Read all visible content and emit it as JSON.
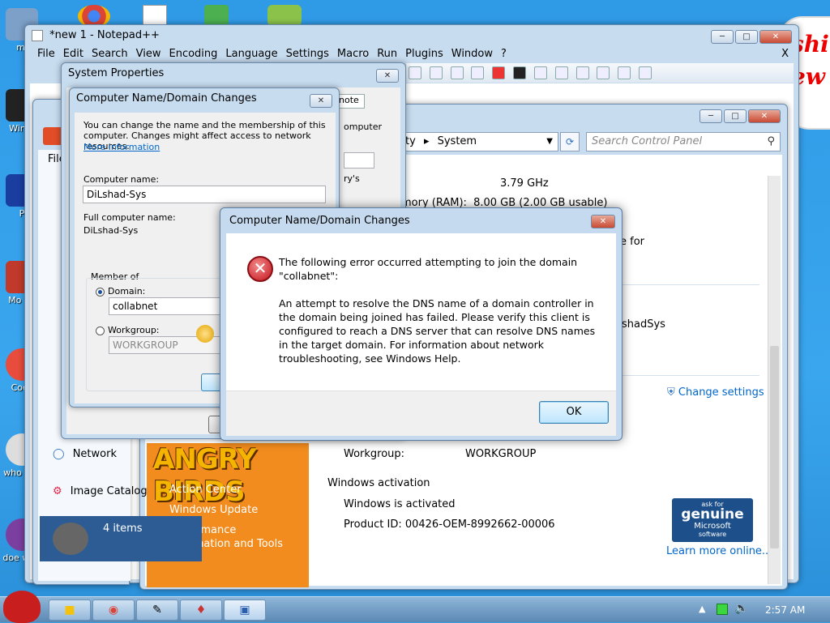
{
  "desktop": {
    "icons": [
      {
        "label": "mi",
        "color": "#7ca0c8"
      },
      {
        "label": "Win V",
        "color": "#222222"
      },
      {
        "label": "P",
        "color": "#1a3ea0"
      },
      {
        "label": "Mo Re",
        "color": "#c0392b"
      },
      {
        "label": "Cock",
        "color": "#e74c3c"
      },
      {
        "label": "who use",
        "color": "#dddddd"
      },
      {
        "label": "doe worl",
        "color": "#7b3fa0"
      }
    ],
    "bubble_text": [
      "shi",
      "ew"
    ]
  },
  "notepad": {
    "title": "*new  1 - Notepad++",
    "menu": [
      "File",
      "Edit",
      "Search",
      "View",
      "Encoding",
      "Language",
      "Settings",
      "Macro",
      "Run",
      "Plugins",
      "Window",
      "?"
    ],
    "menu_close": "X"
  },
  "sysprops": {
    "title": "System Properties",
    "tab_partial": "note",
    "frag_computer": "omputer",
    "frag_ys": "ry's"
  },
  "namechange": {
    "title": "Computer Name/Domain Changes",
    "description": "You can change the name and the membership of this computer. Changes might affect access to network resources.",
    "more_info": "More information",
    "computer_name_label": "Computer name:",
    "computer_name_value": "DiLshad-Sys",
    "full_name_label": "Full computer name:",
    "full_name_value": "DiLshad-Sys",
    "member_of_label": "Member of",
    "domain_label": "Domain:",
    "domain_value": "collabnet",
    "workgroup_label": "Workgroup:",
    "workgroup_value": "WORKGROUP"
  },
  "controlpanel": {
    "breadcrumb_partial": "ty",
    "breadcrumb_current": "System",
    "search_placeholder": "Search Control Panel",
    "file_menu_partial": "File",
    "cpu_speed": "3.79 GHz",
    "memory_label": "mory (RAM):",
    "memory_value": "8.00 GB (2.00 GB usable)",
    "frag_for": "e for",
    "frag_shadsys": "shadSys",
    "change_settings": "Change settings",
    "network_label": "Network",
    "image_catalog_label": "Image Catalog",
    "items_count": "4 items",
    "workgroup_label": "Workgroup:",
    "workgroup_value": "WORKGROUP",
    "activation_heading": "Windows activation",
    "activation_status": "Windows is activated",
    "product_id": "Product ID: 00426-OEM-8992662-00006",
    "learn_more": "Learn more online...",
    "genuine_ask": "ask for",
    "genuine_word": "genuine",
    "genuine_ms": "Microsoft",
    "genuine_sw": "software",
    "see_also": [
      "Action Center",
      "Windows Update",
      "Performance Information and Tools"
    ],
    "angry_birds_logo": "ANGRY BIRDS"
  },
  "error": {
    "title": "Computer Name/Domain Changes",
    "line1": "The following error occurred attempting to join the domain \"collabnet\":",
    "line2": "An attempt to resolve the DNS name of a domain controller in the domain being joined has failed.  Please verify this client is configured to reach a DNS server that can resolve DNS names in the target domain. For information about network troubleshooting, see Windows Help.",
    "ok": "OK"
  },
  "taskbar": {
    "clock": "2:57 AM"
  },
  "colors": {
    "desktop": "#3a9fe0",
    "orange_panel": "#f28c1e",
    "link": "#0066cc",
    "error_red": "#c0141c"
  }
}
